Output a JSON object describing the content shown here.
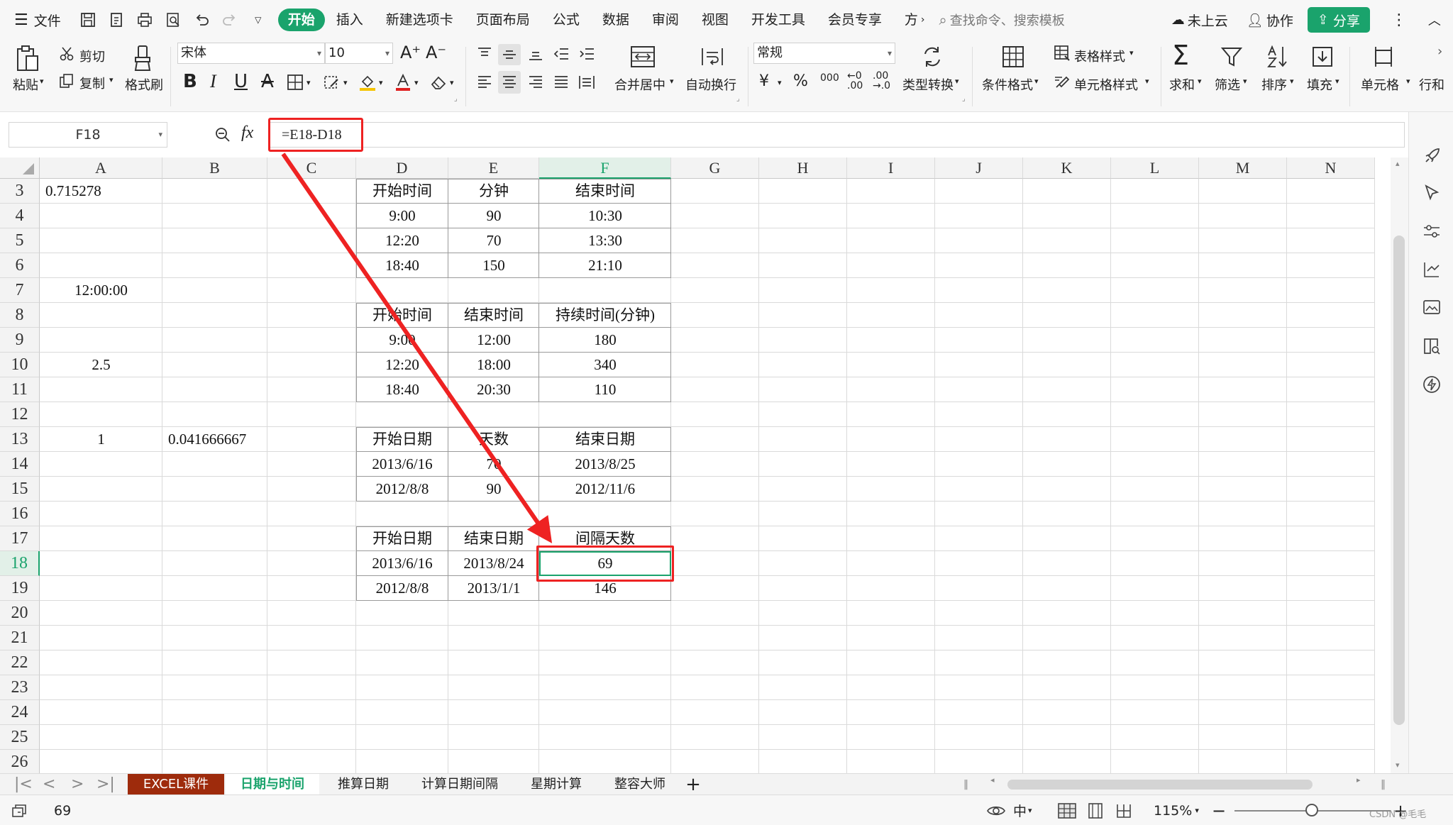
{
  "menubar": {
    "file": "文件",
    "tabs": [
      "开始",
      "插入",
      "新建选项卡",
      "页面布局",
      "公式",
      "数据",
      "审阅",
      "视图",
      "开发工具",
      "会员专享",
      "方"
    ],
    "active_tab": 0,
    "search_placeholder": "查找命令、搜索模板",
    "cloud": "未上云",
    "collab": "协作",
    "share": "分享"
  },
  "ribbon": {
    "paste": "粘贴",
    "cut": "剪切",
    "copy": "复制",
    "format_painter": "格式刷",
    "font_name": "宋体",
    "font_size": "10",
    "merge_center": "合并居中",
    "wrap_text": "自动换行",
    "number_format": "常规",
    "type_convert": "类型转换",
    "cond_format": "条件格式",
    "table_style": "表格样式",
    "cell_style": "单元格样式",
    "sum": "求和",
    "filter": "筛选",
    "sort": "排序",
    "fill": "填充",
    "cells": "单元格",
    "rows_cols": "行和",
    "currency": "¥",
    "percent": "%",
    "thousands": "000"
  },
  "formula_bar": {
    "name_box": "F18",
    "fx": "fx",
    "formula": "=E18-D18"
  },
  "columns": [
    "A",
    "B",
    "C",
    "D",
    "E",
    "F",
    "G",
    "H",
    "I",
    "J",
    "K",
    "L",
    "M",
    "N"
  ],
  "rows": [
    3,
    4,
    5,
    6,
    7,
    8,
    9,
    10,
    11,
    12,
    13,
    14,
    15,
    16,
    17,
    18,
    19,
    20,
    21,
    22,
    23,
    24,
    25,
    26
  ],
  "cells": {
    "A3": "0.715278",
    "A7": "12:00:00",
    "A10": "2.5",
    "A13": "1",
    "B13": "0.041666667",
    "D3": "开始时间",
    "E3": "分钟",
    "F3": "结束时间",
    "D4": "9:00",
    "E4": "90",
    "F4": "10:30",
    "D5": "12:20",
    "E5": "70",
    "F5": "13:30",
    "D6": "18:40",
    "E6": "150",
    "F6": "21:10",
    "D8": "开始时间",
    "E8": "结束时间",
    "F8": "持续时间(分钟)",
    "D9": "9:00",
    "E9": "12:00",
    "F9": "180",
    "D10": "12:20",
    "E10": "18:00",
    "F10": "340",
    "D11": "18:40",
    "E11": "20:30",
    "F11": "110",
    "D13": "开始日期",
    "E13": "天数",
    "F13": "结束日期",
    "D14": "2013/6/16",
    "E14": "70",
    "F14": "2013/8/25",
    "D15": "2012/8/8",
    "E15": "90",
    "F15": "2012/11/6",
    "D17": "开始日期",
    "E17": "结束日期",
    "F17": "间隔天数",
    "D18": "2013/6/16",
    "E18": "2013/8/24",
    "F18": "69",
    "D19": "2012/8/8",
    "E19": "2013/1/1",
    "F19": "146"
  },
  "selected_cell": "F18",
  "sheet_tabs": [
    "EXCEL课件",
    "日期与时间",
    "推算日期",
    "计算日期间隔",
    "星期计算",
    "整容大师"
  ],
  "active_sheet": 1,
  "statusbar": {
    "value": "69",
    "zoom": "115%",
    "watermark": "CSDN @毛毛"
  },
  "colors": {
    "accent": "#1aa36c",
    "highlight": "#ee2222",
    "tab_dark": "#9e2b0c"
  }
}
